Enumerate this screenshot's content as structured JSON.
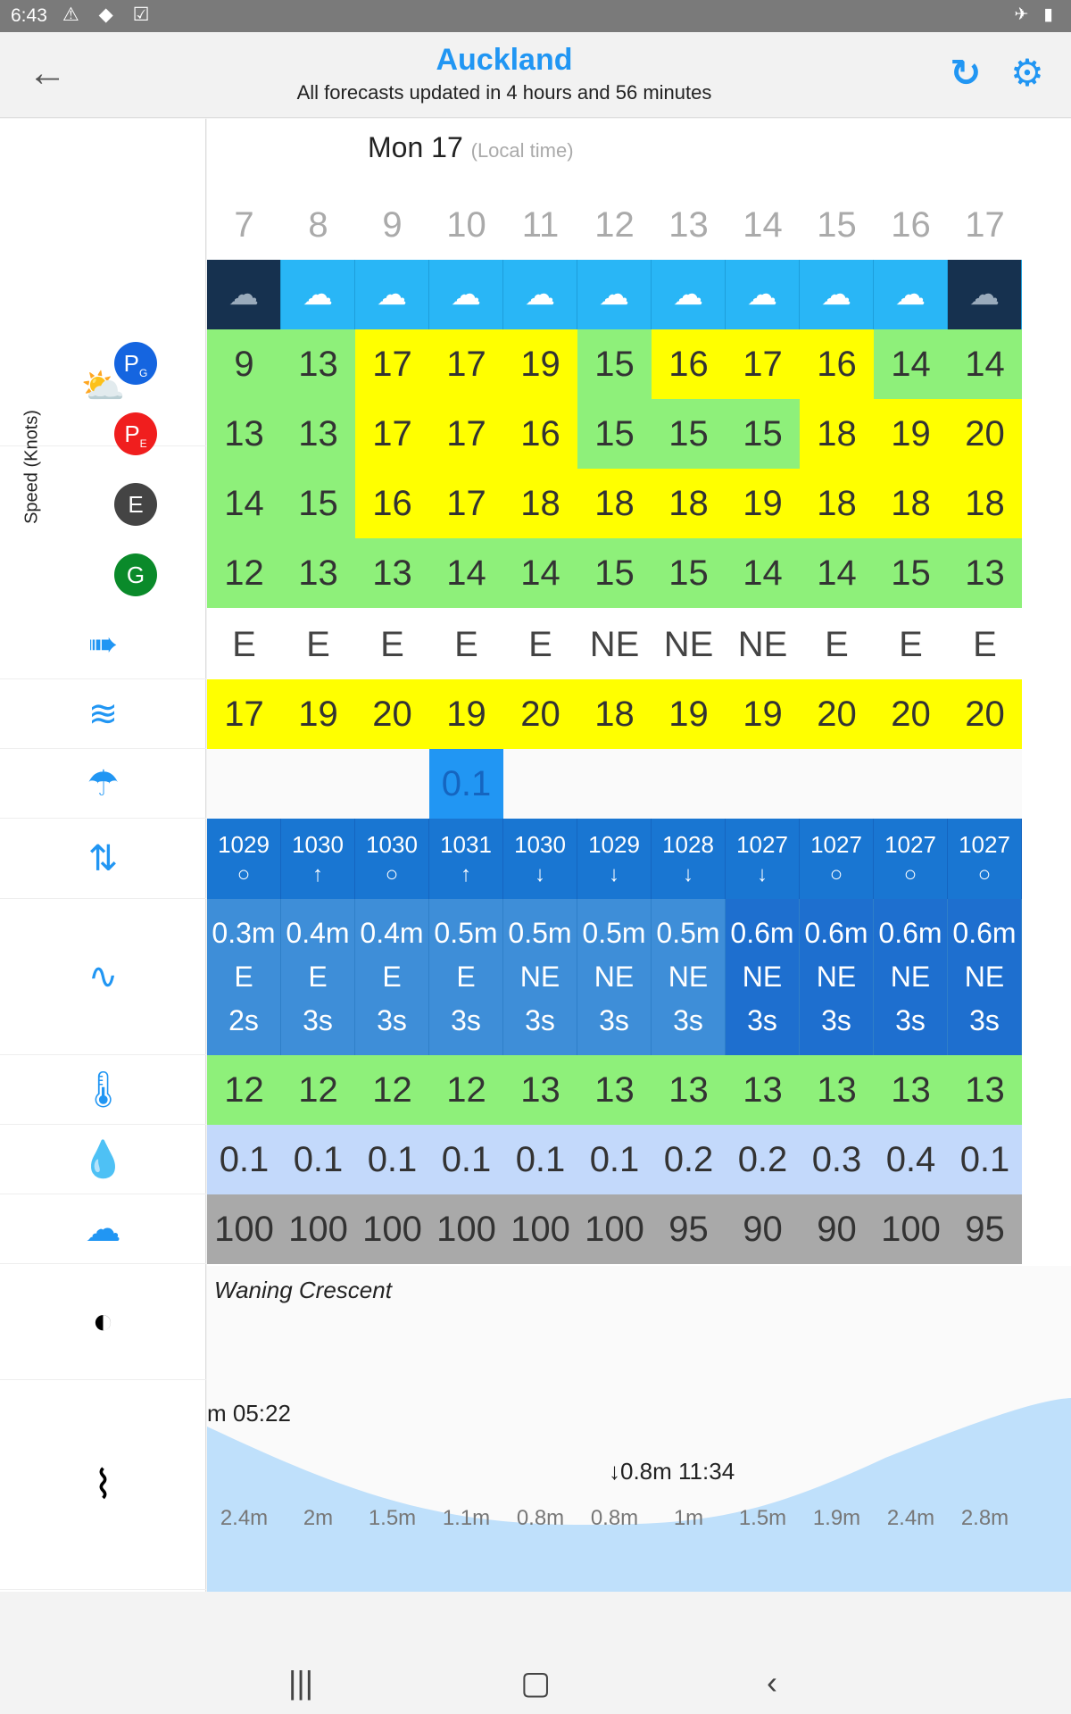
{
  "status": {
    "time": "6:43"
  },
  "header": {
    "title": "Auckland",
    "subtitle": "All forecasts updated in 4 hours and 56 minutes",
    "back_icon": "arrow-left-icon",
    "refresh_icon": "refresh-icon",
    "settings_icon": "gear-icon"
  },
  "day": {
    "label": "Mon 17",
    "note": "(Local time)"
  },
  "left_panel": {
    "speed_label": "Speed (Knots)",
    "models": [
      {
        "letter": "P",
        "sub": "G",
        "color": "#1565e0"
      },
      {
        "letter": "P",
        "sub": "E",
        "color": "#f01e1e"
      },
      {
        "letter": "E",
        "sub": "",
        "color": "#444444"
      },
      {
        "letter": "G",
        "sub": "",
        "color": "#0a8a2a"
      }
    ]
  },
  "hours": [
    "7",
    "8",
    "9",
    "10",
    "11",
    "12",
    "13",
    "14",
    "15",
    "16",
    "17"
  ],
  "wind": {
    "pg": [
      "9",
      "13",
      "17",
      "17",
      "19",
      "15",
      "16",
      "17",
      "16",
      "14",
      "14"
    ],
    "pe": [
      "13",
      "13",
      "17",
      "17",
      "16",
      "15",
      "15",
      "15",
      "18",
      "19",
      "20"
    ],
    "e": [
      "14",
      "15",
      "16",
      "17",
      "18",
      "18",
      "18",
      "19",
      "18",
      "18",
      "18"
    ],
    "g": [
      "12",
      "13",
      "13",
      "14",
      "14",
      "15",
      "15",
      "14",
      "14",
      "15",
      "13"
    ]
  },
  "direction": [
    "E",
    "E",
    "E",
    "E",
    "E",
    "NE",
    "NE",
    "NE",
    "E",
    "E",
    "E"
  ],
  "gust": [
    "17",
    "19",
    "20",
    "19",
    "20",
    "18",
    "19",
    "19",
    "20",
    "20",
    "20"
  ],
  "rain": {
    "hour_index": 3,
    "value": "0.1"
  },
  "pressure": [
    "1029",
    "1030",
    "1030",
    "1031",
    "1030",
    "1029",
    "1028",
    "1027",
    "1027",
    "1027",
    "1027"
  ],
  "pressure_trend": [
    "○",
    "↑",
    "○",
    "↑",
    "↓",
    "↓",
    "↓",
    "↓",
    "○",
    "○",
    "○"
  ],
  "wave_height": [
    "0.3m",
    "0.4m",
    "0.4m",
    "0.5m",
    "0.5m",
    "0.5m",
    "0.5m",
    "0.6m",
    "0.6m",
    "0.6m",
    "0.6m"
  ],
  "wave_dir": [
    "E",
    "E",
    "E",
    "E",
    "NE",
    "NE",
    "NE",
    "NE",
    "NE",
    "NE",
    "NE"
  ],
  "wave_period": [
    "2s",
    "3s",
    "3s",
    "3s",
    "3s",
    "3s",
    "3s",
    "3s",
    "3s",
    "3s",
    "3s"
  ],
  "temperature": [
    "12",
    "12",
    "12",
    "12",
    "13",
    "13",
    "13",
    "13",
    "13",
    "13",
    "13"
  ],
  "humidity": [
    "0.1",
    "0.1",
    "0.1",
    "0.1",
    "0.1",
    "0.1",
    "0.2",
    "0.2",
    "0.3",
    "0.4",
    "0.1"
  ],
  "cloud": [
    "100",
    "100",
    "100",
    "100",
    "100",
    "100",
    "95",
    "90",
    "90",
    "100",
    "95"
  ],
  "moon": {
    "phase": "Waning Crescent"
  },
  "tide": {
    "high_label": "m 05:22",
    "low_label": "↓0.8m 11:34",
    "heights": [
      "2.4m",
      "2m",
      "1.5m",
      "1.1m",
      "0.8m",
      "0.8m",
      "1m",
      "1.5m",
      "1.9m",
      "2.4m",
      "2.8m"
    ]
  },
  "colors": {
    "accent": "#2196f3",
    "high": "#ffff00",
    "mid": "#8ef07a",
    "pressure": "#1976d2",
    "waves": "#3e8ed8"
  }
}
